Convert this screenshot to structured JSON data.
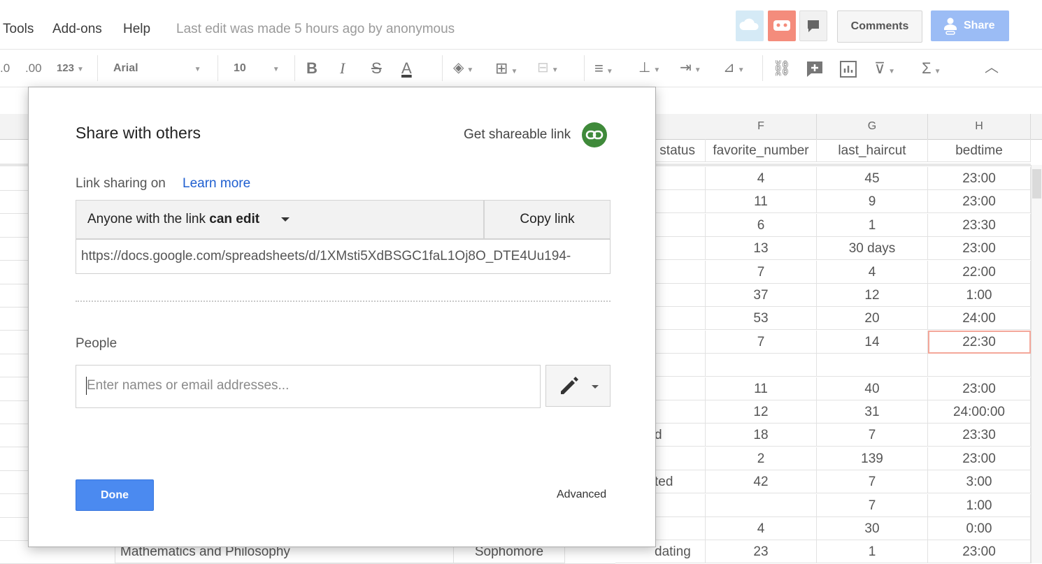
{
  "menubar": {
    "items": [
      "Tools",
      "Add-ons",
      "Help"
    ],
    "last_edit": "Last edit was made 5 hours ago by anonymous",
    "comments_label": "Comments",
    "share_label": "Share"
  },
  "toolbar": {
    "decimal_less": ".0",
    "decimal_more": ".00",
    "format_more": "123",
    "font": "Arial",
    "font_size": "10",
    "icons": [
      "bold-icon",
      "italic-icon",
      "strikethrough-icon",
      "text-color-icon",
      "fill-color-icon",
      "borders-icon",
      "merge-cells-icon",
      "align-left-icon",
      "vertical-align-icon",
      "text-wrap-icon",
      "text-rotation-icon",
      "link-icon",
      "insert-comment-icon",
      "insert-chart-icon",
      "filter-icon",
      "functions-icon",
      "collapse-icon"
    ]
  },
  "grid": {
    "columns": [
      {
        "letter": "F",
        "header": "favorite_number"
      },
      {
        "letter": "G",
        "header": "last_haircut"
      },
      {
        "letter": "H",
        "header": "bedtime"
      }
    ],
    "partial_header": "status",
    "rows": [
      {
        "e": "",
        "f": "4",
        "g": "45",
        "h": "23:00"
      },
      {
        "e": "",
        "f": "11",
        "g": "9",
        "h": "23:00"
      },
      {
        "e": "",
        "f": "6",
        "g": "1",
        "h": "23:30"
      },
      {
        "e": "",
        "f": "13",
        "g": "30 days",
        "h": "23:00"
      },
      {
        "e": "",
        "f": "7",
        "g": "4",
        "h": "22:00"
      },
      {
        "e": "",
        "f": "37",
        "g": "12",
        "h": "1:00"
      },
      {
        "e": "",
        "f": "53",
        "g": "20",
        "h": "24:00"
      },
      {
        "e": "",
        "f": "7",
        "g": "14",
        "h": "22:30"
      },
      {
        "e": "",
        "f": "",
        "g": "",
        "h": ""
      },
      {
        "e": "",
        "f": "11",
        "g": "40",
        "h": "23:00"
      },
      {
        "e": "",
        "f": "12",
        "g": "31",
        "h": "24:00:00"
      },
      {
        "e": "d",
        "f": "18",
        "g": "7",
        "h": "23:30"
      },
      {
        "e": "",
        "f": "2",
        "g": "139",
        "h": "23:00"
      },
      {
        "e": "ted",
        "f": "42",
        "g": "7",
        "h": "3:00"
      },
      {
        "e": "",
        "f": "",
        "g": "7",
        "h": "1:00"
      },
      {
        "e": "",
        "f": "4",
        "g": "30",
        "h": "0:00"
      },
      {
        "e": "dating",
        "f": "23",
        "g": "1",
        "h": "23:00"
      }
    ],
    "last_row_b": "Mathematics and Philosophy",
    "last_row_c": "Sophomore"
  },
  "dialog": {
    "title": "Share with others",
    "get_link": "Get shareable link",
    "link_sharing": "Link sharing on",
    "learn_more": "Learn more",
    "access_prefix": "Anyone with the link ",
    "access_bold": "can edit",
    "copy_link": "Copy link",
    "url": "https://docs.google.com/spreadsheets/d/1XMsti5XdBSGC1faL1Oj8O_DTE4Uu194-",
    "people_label": "People",
    "people_placeholder": "Enter names or email addresses...",
    "done": "Done",
    "advanced": "Advanced"
  },
  "colors": {
    "accent": "#4b8af0",
    "link": "#1f5fd0",
    "share_button": "#9bbcf5",
    "link_icon_bg": "#3f8a3a",
    "selected_cell": "#f4a79a"
  }
}
